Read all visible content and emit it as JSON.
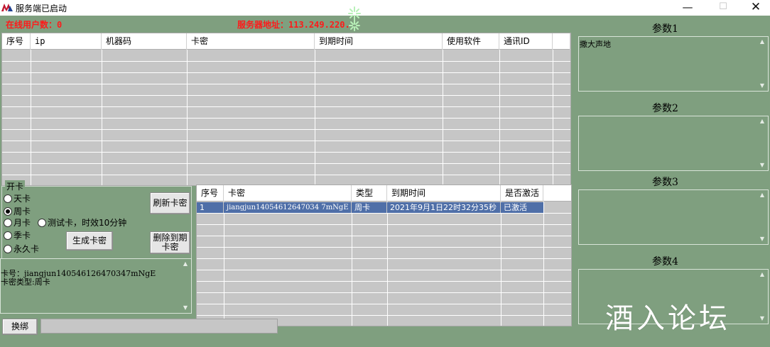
{
  "window": {
    "title": "服务端已启动",
    "minimize_glyph": "—",
    "maximize_glyph": "☐",
    "close_glyph": "✕"
  },
  "status": {
    "online_users": "在线用户数：0",
    "server_address": "服务器地址：113.249.220.",
    "text_color": "#ff1a1a"
  },
  "user_table": {
    "columns": [
      "序号",
      "ip",
      "机器码",
      "卡密",
      "到期时间",
      "使用软件",
      "通讯ID"
    ]
  },
  "open_card": {
    "title": "开卡",
    "options": {
      "day": "天卡",
      "week": "周卡",
      "month": "月卡",
      "trial": "测试卡，时效10分钟",
      "season": "季卡",
      "permanent": "永久卡"
    },
    "selected": "周卡",
    "refresh_button": "刷新卡密",
    "generate_button": "生成卡密",
    "delete_button_line1": "删除到期",
    "delete_button_line2": "卡密"
  },
  "card_table": {
    "columns": [
      "序号",
      "卡密",
      "类型",
      "到期时间",
      "是否激活"
    ],
    "rows": [
      [
        "1",
        "jiangjun14054612647034 7mNgE",
        "周卡",
        "2021年9月1日22时32分35秒",
        "已激活"
      ]
    ],
    "selection_color": "#4f6fa8"
  },
  "card_info": {
    "line1": "卡号：jiangjun140546126470347mNgE",
    "line2": "卡密类型:周卡"
  },
  "params": [
    {
      "label": "参数1",
      "value": "撒大声地"
    },
    {
      "label": "参数2",
      "value": ""
    },
    {
      "label": "参数3",
      "value": ""
    },
    {
      "label": "参数4",
      "value": ""
    }
  ],
  "bind_button": "换绑",
  "watermark": "酒入论坛",
  "colors": {
    "background": "#7f9f7f",
    "grid": "#c6c6c6"
  }
}
